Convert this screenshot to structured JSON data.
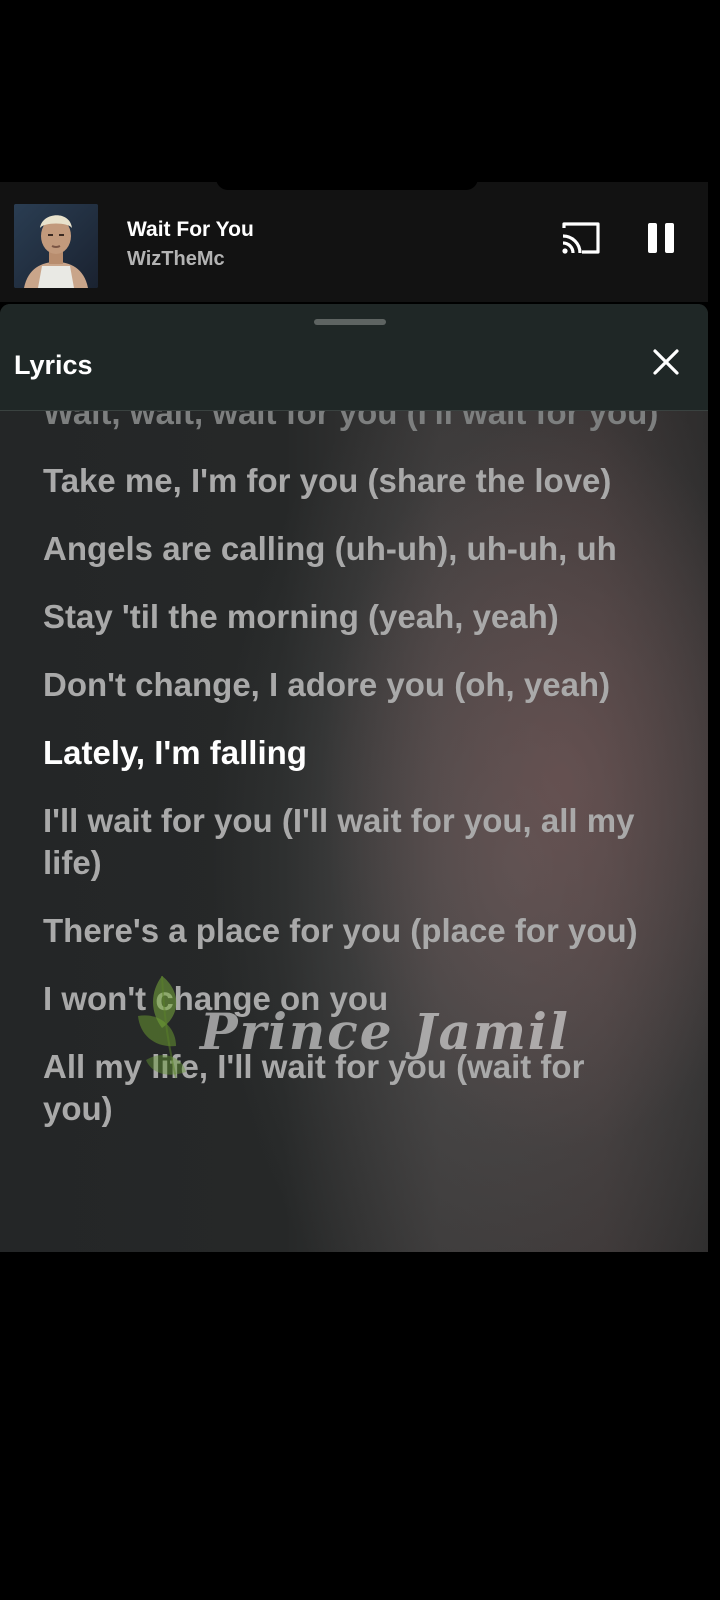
{
  "now_playing": {
    "title": "Wait For You",
    "artist": "WizTheMc",
    "cast_icon": "cast-icon",
    "pause_icon": "pause-icon"
  },
  "lyrics_panel": {
    "title": "Lyrics",
    "close_icon": "close-icon",
    "lines": [
      {
        "text": "Wait, wait, wait for you (I'll wait for you)",
        "state": "past"
      },
      {
        "text": "Take me, I'm for you (share the love)",
        "state": "past"
      },
      {
        "text": "Angels are calling (uh-uh), uh-uh, uh",
        "state": "past"
      },
      {
        "text": "Stay 'til the morning (yeah, yeah)",
        "state": "past"
      },
      {
        "text": "Don't change, I adore you (oh, yeah)",
        "state": "past"
      },
      {
        "text": "Lately, I'm falling",
        "state": "current"
      },
      {
        "text": "I'll wait for you (I'll wait for you, all my life)",
        "state": "upcoming"
      },
      {
        "text": "There's a place for you (place for you)",
        "state": "upcoming"
      },
      {
        "text": "I won't change on you",
        "state": "upcoming"
      },
      {
        "text": "All my life, I'll wait for you (wait for you)",
        "state": "upcoming"
      }
    ]
  },
  "watermark": {
    "text": "Prince Jamil",
    "icon": "leaf-icon"
  },
  "colors": {
    "active_lyric": "#ffffff",
    "inactive_lyric": "#a9a9a9",
    "header_bg": "#1f2726",
    "player_bg": "#121212"
  }
}
